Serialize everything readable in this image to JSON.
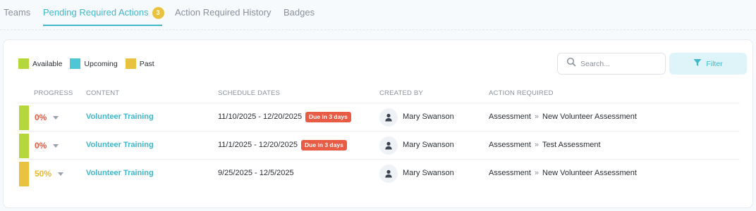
{
  "tabs": [
    {
      "label": "Teams"
    },
    {
      "label": "Pending Required Actions",
      "badge": "3"
    },
    {
      "label": "Action Required History"
    },
    {
      "label": "Badges"
    }
  ],
  "legend": [
    {
      "label": "Available",
      "color": "#b5d63c"
    },
    {
      "label": "Upcoming",
      "color": "#4ec6d6"
    },
    {
      "label": "Past",
      "color": "#e9c23f"
    }
  ],
  "search": {
    "placeholder": "Search..."
  },
  "filter": {
    "label": "Filter"
  },
  "table": {
    "headers": [
      "PROGRESS",
      "CONTENT",
      "SCHEDULE DATES",
      "CREATED BY",
      "ACTION REQUIRED"
    ],
    "rows": [
      {
        "status_color": "#b5d63c",
        "progress": "0%",
        "progress_color": "#e85b45",
        "content": "Volunteer Training",
        "dates": "11/10/2025 - 12/20/2025",
        "due": "Due in 3 days",
        "created_by": "Mary Swanson",
        "action_type": "Assessment",
        "action_name": "New Volunteer Assessment"
      },
      {
        "status_color": "#b5d63c",
        "progress": "0%",
        "progress_color": "#e85b45",
        "content": "Volunteer Training",
        "dates": "11/1/2025 - 12/20/2025",
        "due": "Due in 3 days",
        "created_by": "Mary Swanson",
        "action_type": "Assessment",
        "action_name": "Test Assessment"
      },
      {
        "status_color": "#e9c23f",
        "progress": "50%",
        "progress_color": "#e9b92f",
        "content": "Volunteer Training",
        "dates": "9/25/2025 - 12/5/2025",
        "due": "",
        "created_by": "Mary Swanson",
        "action_type": "Assessment",
        "action_name": "New Volunteer Assessment"
      }
    ]
  }
}
